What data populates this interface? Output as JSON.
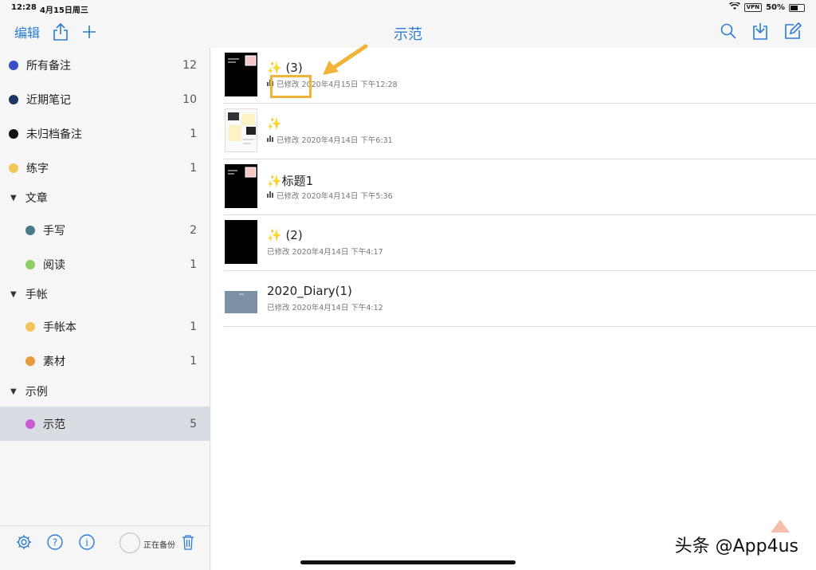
{
  "status_bar": {
    "time": "12:28",
    "date": "4月15日周三",
    "vpn": "VPN",
    "battery": "50%"
  },
  "nav": {
    "edit_label": "编辑",
    "title": "示范",
    "icons": [
      "share-icon",
      "plus-icon",
      "search-icon",
      "import-icon",
      "compose-icon"
    ]
  },
  "sidebar": {
    "items": [
      {
        "label": "所有备注",
        "count": "12",
        "color": "#3a4fc7"
      },
      {
        "label": "近期笔记",
        "count": "10",
        "color": "#1f3566"
      },
      {
        "label": "未归档备注",
        "count": "1",
        "color": "#111111"
      },
      {
        "label": "练字",
        "count": "1",
        "color": "#f0c65a"
      }
    ],
    "groups": [
      {
        "label": "文章",
        "children": [
          {
            "label": "手写",
            "count": "2",
            "color": "#4a7a85"
          },
          {
            "label": "阅读",
            "count": "1",
            "color": "#8fcf6a"
          }
        ]
      },
      {
        "label": "手帐",
        "children": [
          {
            "label": "手帐本",
            "count": "1",
            "color": "#f0c65a"
          },
          {
            "label": "素材",
            "count": "1",
            "color": "#e69a3a"
          }
        ]
      },
      {
        "label": "示例",
        "children": [
          {
            "label": "示范",
            "count": "5",
            "color": "#c95bd0"
          }
        ]
      }
    ],
    "footer": {
      "backup_label": "正在备份",
      "icons": [
        "gear-icon",
        "help-icon",
        "info-icon",
        "trash-icon"
      ]
    }
  },
  "notes": [
    {
      "title": "✨ (3)",
      "meta": "已修改 2020年4月15日 下午12:28",
      "has_audio": true
    },
    {
      "title": "✨",
      "meta": "已修改 2020年4月14日 下午6:31",
      "has_audio": true
    },
    {
      "title": "✨标题1",
      "meta": "已修改 2020年4月14日 下午5:36",
      "has_audio": true
    },
    {
      "title": "✨ (2)",
      "meta": "已修改 2020年4月14日 下午4:17",
      "has_audio": false
    },
    {
      "title": "2020_Diary(1)",
      "meta": "已修改 2020年4月14日 下午4:12",
      "has_audio": false
    }
  ],
  "watermark": "头条 @App4us"
}
